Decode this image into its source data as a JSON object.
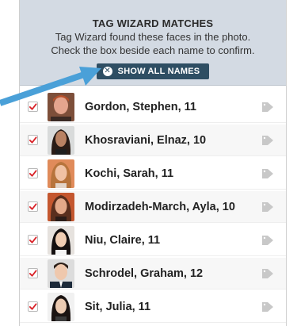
{
  "header": {
    "title": "TAG WIZARD MATCHES",
    "line1": "Tag Wizard found these faces in the photo.",
    "line2": "Check the box beside each name to confirm.",
    "button_label": "SHOW ALL NAMES"
  },
  "colors": {
    "header_bg": "#d3dae3",
    "button_bg": "#2e4e63",
    "check": "#d9242a",
    "arrow": "#4aa0d8",
    "tag": "#c8c8c8"
  },
  "matches": [
    {
      "name": "Gordon, Stephen, 11",
      "checked": true,
      "icon": "tag-icon"
    },
    {
      "name": "Khosraviani, Elnaz, 10",
      "checked": true,
      "icon": "tag-icon"
    },
    {
      "name": "Kochi, Sarah, 11",
      "checked": true,
      "icon": "tag-icon"
    },
    {
      "name": "Modirzadeh-March, Ayla, 10",
      "checked": true,
      "icon": "tag-icon"
    },
    {
      "name": "Niu, Claire, 11",
      "checked": true,
      "icon": "tag-icon"
    },
    {
      "name": "Schrodel, Graham, 12",
      "checked": true,
      "icon": "tag-icon"
    },
    {
      "name": "Sit, Julia, 11",
      "checked": true,
      "icon": "tag-icon"
    }
  ]
}
